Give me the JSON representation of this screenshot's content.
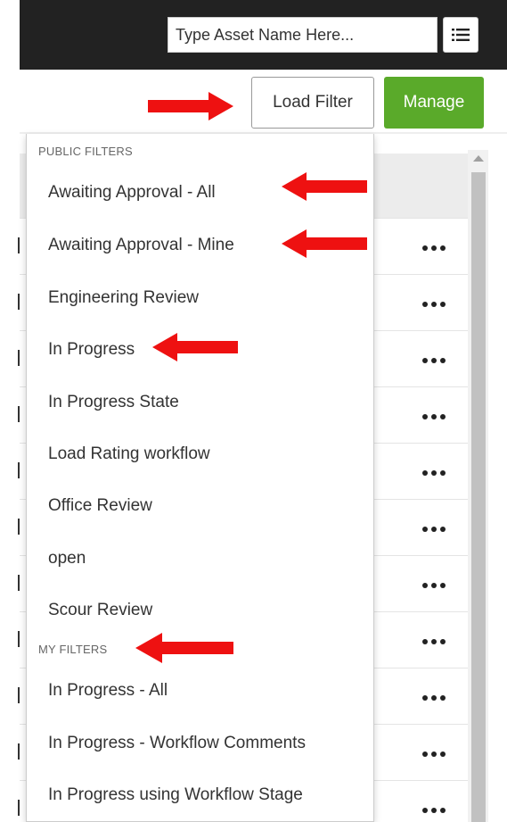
{
  "header": {
    "search_placeholder": "Type Asset Name Here...",
    "list_icon": "list-icon"
  },
  "toolbar": {
    "load_filter_label": "Load Filter",
    "manage_label": "Manage",
    "manage_color": "#5aaa2a"
  },
  "dropdown": {
    "sections": [
      {
        "title": "PUBLIC FILTERS",
        "items": [
          "Awaiting Approval - All",
          "Awaiting Approval - Mine",
          "Engineering Review",
          "In Progress",
          "In Progress State",
          "Load Rating workflow",
          "Office Review",
          "open",
          "Scour Review"
        ]
      },
      {
        "title": "MY FILTERS",
        "items": [
          "In Progress - All",
          "In Progress - Workflow Comments",
          "In Progress using Workflow Stage"
        ]
      }
    ]
  },
  "table": {
    "row_action_icon": "ellipsis-icon"
  },
  "annotation_color": "#ee1111"
}
